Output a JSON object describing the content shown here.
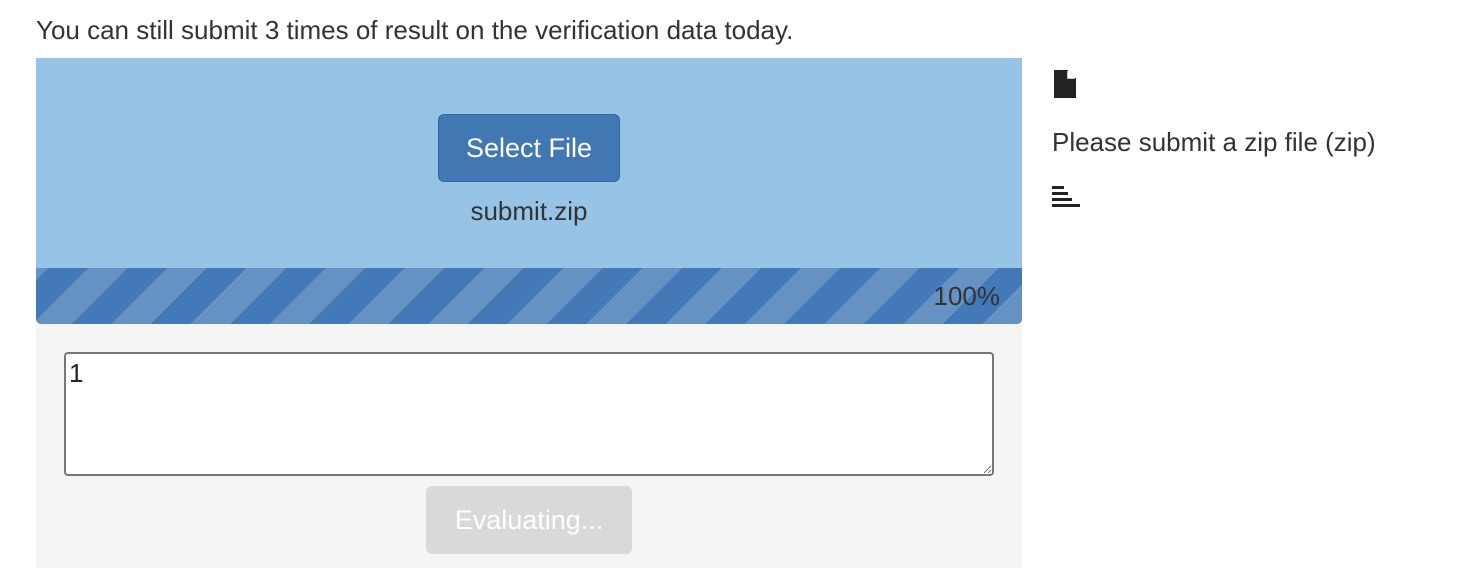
{
  "notice": {
    "text": "You can still submit 3 times of result on the verification data today."
  },
  "upload": {
    "select_button_label": "Select File",
    "filename": "submit.zip",
    "progress_text": "100%",
    "progress_value": 1.0,
    "result_text": "1",
    "evaluate_button_label": "Evaluating..."
  },
  "sidebar": {
    "file_icon": "file-icon",
    "hint": "Please submit a zip file (zip)",
    "align_icon": "align-left-icon"
  },
  "colors": {
    "dropzone": "#97c3e6",
    "primary_button": "#4178b4",
    "progress_bar": "#4379b6",
    "disabled_button": "#d9d9d9",
    "panel_background": "#f5f5f5"
  }
}
